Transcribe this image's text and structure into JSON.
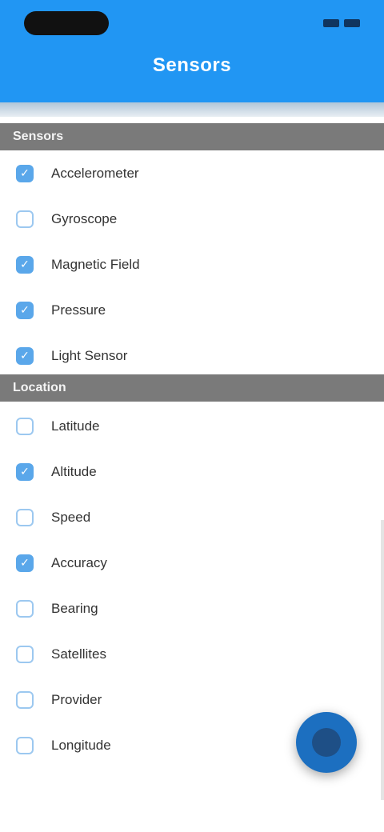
{
  "app": {
    "title": "Sensors"
  },
  "statusbar": {
    "time": "",
    "battery_icon": "battery-icon",
    "signal_icon": "signal-icon"
  },
  "sections": [
    {
      "header": "Sensors",
      "items": [
        {
          "label": "Accelerometer",
          "checked": true
        },
        {
          "label": "Gyroscope",
          "checked": false
        },
        {
          "label": "Magnetic Field",
          "checked": true
        },
        {
          "label": "Pressure",
          "checked": true
        },
        {
          "label": "Light Sensor",
          "checked": true
        }
      ]
    },
    {
      "header": "Location",
      "items": [
        {
          "label": "Latitude",
          "checked": false
        },
        {
          "label": "Altitude",
          "checked": true
        },
        {
          "label": "Speed",
          "checked": false
        },
        {
          "label": "Accuracy",
          "checked": true
        },
        {
          "label": "Bearing",
          "checked": false
        },
        {
          "label": "Satellites",
          "checked": false
        },
        {
          "label": "Provider",
          "checked": false
        },
        {
          "label": "Longitude",
          "checked": false
        }
      ]
    }
  ],
  "fab": {
    "icon": "record-icon"
  },
  "colors": {
    "primary": "#2196f3",
    "section_header": "#7a7a7a",
    "checkbox_checked": "#5aa7ea",
    "fab": "#1c6fc0"
  }
}
